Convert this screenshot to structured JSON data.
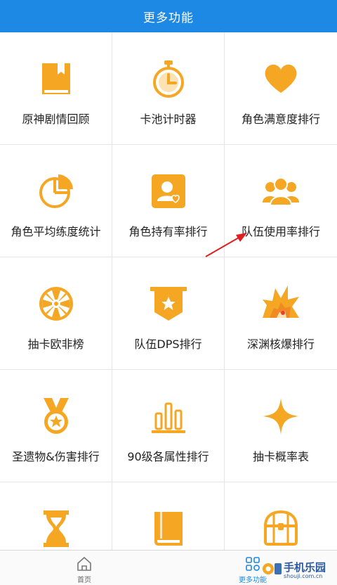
{
  "header": {
    "title": "更多功能"
  },
  "items": [
    {
      "label": "原神剧情回顾",
      "icon": "book-icon"
    },
    {
      "label": "卡池计时器",
      "icon": "stopwatch-icon"
    },
    {
      "label": "角色满意度排行",
      "icon": "heart-icon"
    },
    {
      "label": "角色平均练度统计",
      "icon": "pie-chart-icon"
    },
    {
      "label": "角色持有率排行",
      "icon": "user-card-icon"
    },
    {
      "label": "队伍使用率排行",
      "icon": "group-icon"
    },
    {
      "label": "抽卡欧非榜",
      "icon": "wheel-icon"
    },
    {
      "label": "队伍DPS排行",
      "icon": "star-banner-icon"
    },
    {
      "label": "深渊核爆排行",
      "icon": "explosion-icon"
    },
    {
      "label": "圣遗物&伤害排行",
      "icon": "medal-icon"
    },
    {
      "label": "90级各属性排行",
      "icon": "bar-chart-icon"
    },
    {
      "label": "抽卡概率表",
      "icon": "sparkle-icon"
    },
    {
      "label": "",
      "icon": "hourglass-icon"
    },
    {
      "label": "",
      "icon": "notebook-icon"
    },
    {
      "label": "",
      "icon": "treasure-chest-icon"
    }
  ],
  "tabs": [
    {
      "label": "首页",
      "icon": "home-icon",
      "active": false
    },
    {
      "label": "更多功能",
      "icon": "apps-icon",
      "active": true
    }
  ],
  "watermark": {
    "text": "手机乐园",
    "subtext": "shouji.com.cn"
  },
  "colors": {
    "header": "#1e88e5",
    "accent": "#f5a623",
    "annotation": "#e02020"
  }
}
